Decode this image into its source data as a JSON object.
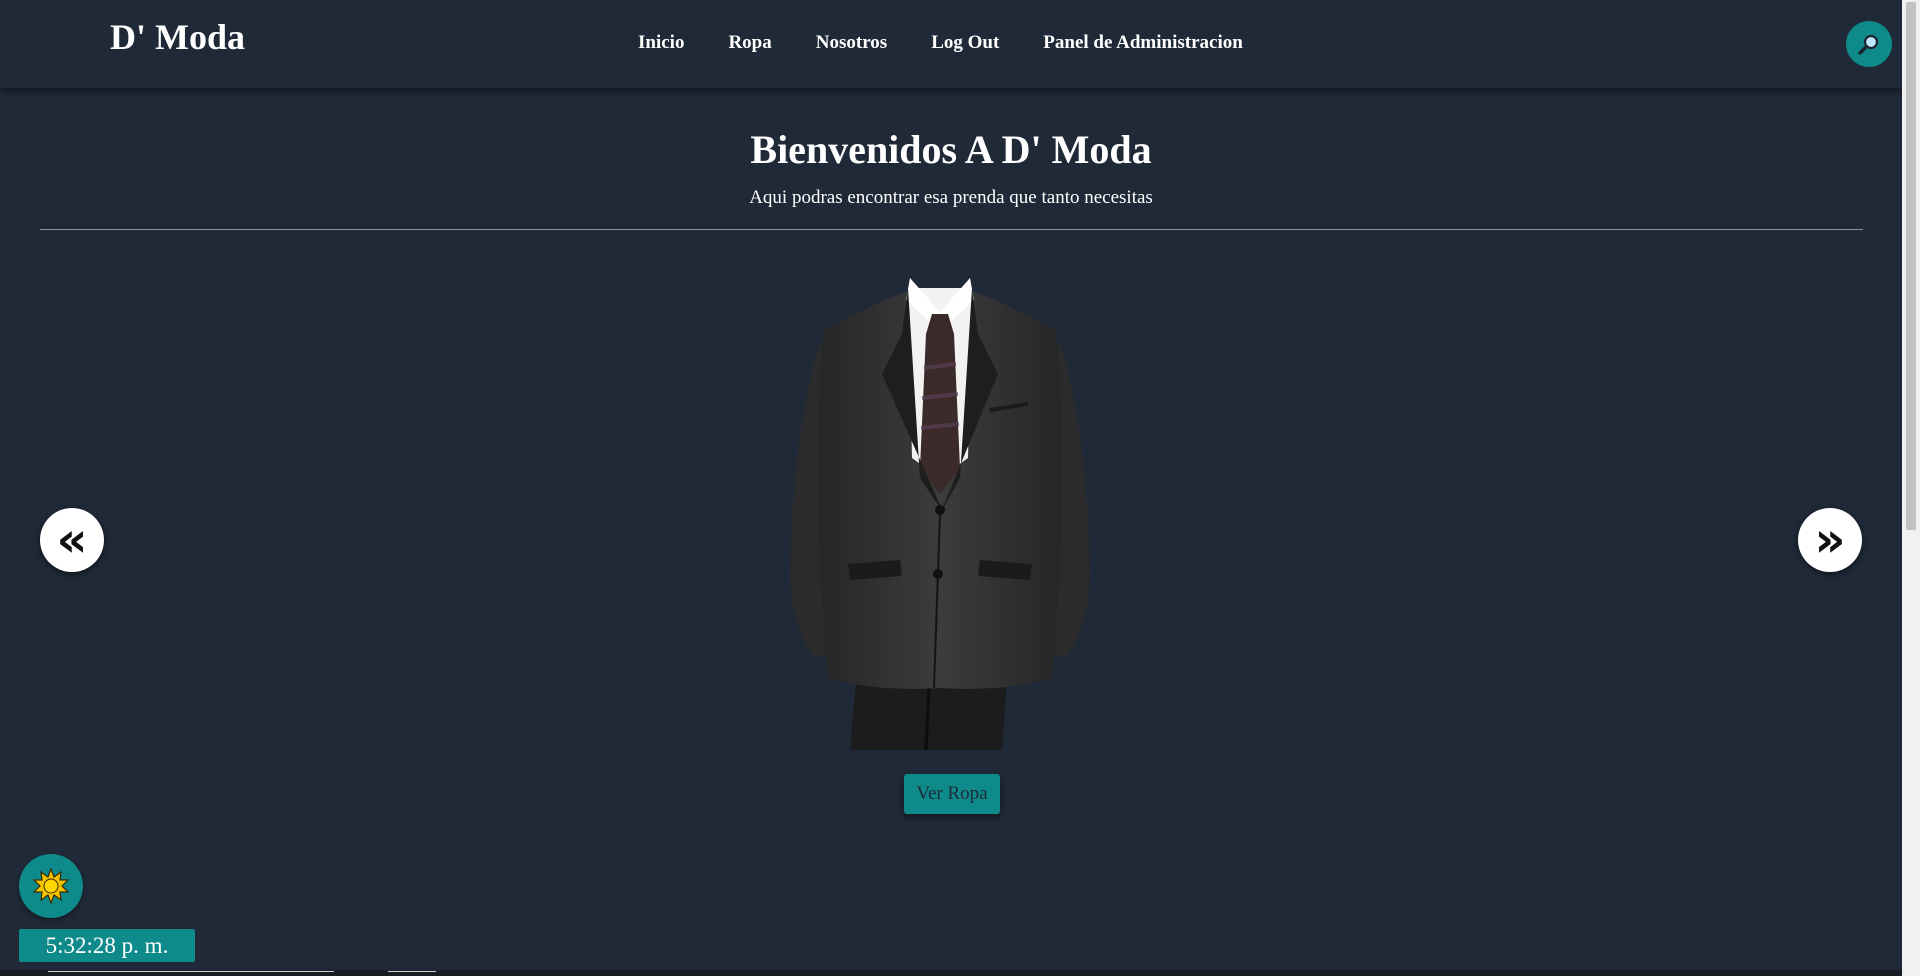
{
  "brand": "D' Moda",
  "nav": {
    "links": [
      {
        "label": "Inicio"
      },
      {
        "label": "Ropa"
      },
      {
        "label": "Nosotros"
      },
      {
        "label": "Log Out"
      },
      {
        "label": "Panel de Administracion"
      }
    ],
    "search_icon": "search-icon"
  },
  "hero": {
    "title": "Bienvenidos A D' Moda",
    "subtitle": "Aqui podras encontrar esa prenda que tanto necesitas"
  },
  "carousel": {
    "prev_label": "«",
    "next_label": "»",
    "image": "suit-image"
  },
  "cta": {
    "label": "Ver Ropa"
  },
  "theme_toggle": {
    "icon": "sun-icon"
  },
  "clock": {
    "time": "5:32:28 p. m."
  },
  "colors": {
    "background": "#1f2937",
    "accent": "#0f8a8a",
    "text": "#ffffff"
  }
}
